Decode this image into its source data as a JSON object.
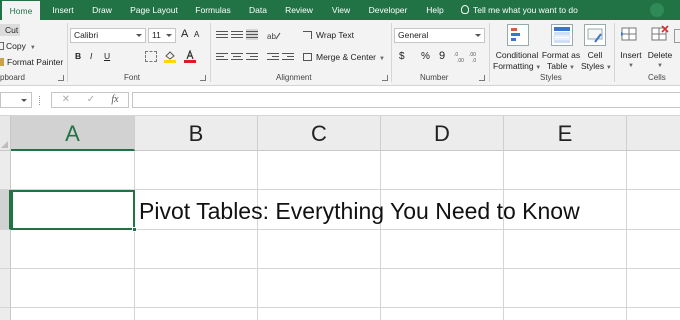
{
  "ribbon": {
    "tabs": [
      {
        "label": "Home",
        "active": true
      },
      {
        "label": "Insert"
      },
      {
        "label": "Draw"
      },
      {
        "label": "Page Layout"
      },
      {
        "label": "Formulas"
      },
      {
        "label": "Data"
      },
      {
        "label": "Review"
      },
      {
        "label": "View"
      },
      {
        "label": "Developer"
      },
      {
        "label": "Help"
      }
    ],
    "tell_me": "Tell me what you want to do",
    "clipboard": {
      "cut": "Cut",
      "copy": "Copy",
      "format_painter": "Format Painter",
      "group_label": "pboard"
    },
    "font": {
      "name": "Calibri",
      "size": "11",
      "bold": "B",
      "italic": "I",
      "underline": "U",
      "grow": "A",
      "shrink": "A",
      "group_label": "Font"
    },
    "alignment": {
      "wrap_text": "Wrap Text",
      "merge_center": "Merge & Center",
      "group_label": "Alignment"
    },
    "number": {
      "format": "General",
      "currency": "$",
      "percent": "%",
      "comma": "9",
      "group_label": "Number"
    },
    "styles": {
      "conditional_1": "Conditional",
      "conditional_2": "Formatting",
      "format_table_1": "Format as",
      "format_table_2": "Table",
      "cell_styles_1": "Cell",
      "cell_styles_2": "Styles",
      "group_label": "Styles"
    },
    "cells": {
      "insert": "Insert",
      "delete": "Delete",
      "group_label": "Cells"
    }
  },
  "formula_bar": {
    "cancel": "✕",
    "enter": "✓",
    "fx": "fx",
    "value": ""
  },
  "grid": {
    "columns": [
      "A",
      "B",
      "C",
      "D",
      "E"
    ],
    "selected_column": "A",
    "cell_text": "Pivot Tables: Everything You Need to Know"
  },
  "colors": {
    "accent": "#217346"
  }
}
